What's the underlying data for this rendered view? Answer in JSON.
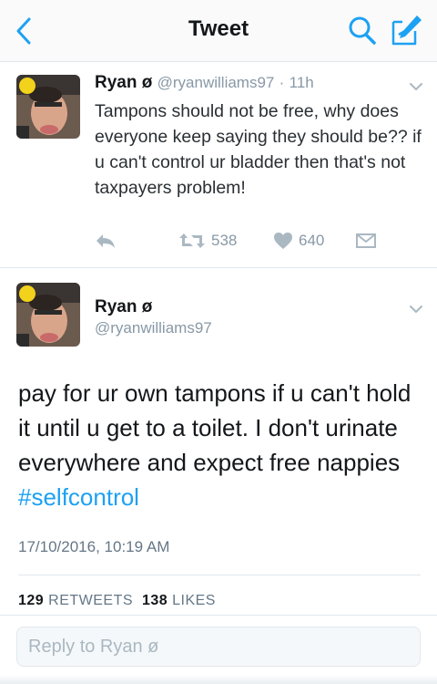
{
  "header": {
    "title": "Tweet",
    "back_icon": "chevron-left-icon",
    "search_icon": "search-icon",
    "compose_icon": "compose-icon"
  },
  "tweet1": {
    "name": "Ryan ø",
    "handle": "@ryanwilliams97",
    "separator": "·",
    "time": "11h",
    "text": "Tampons should not be free, why does everyone keep saying they should be?? if u can't control ur bladder then that's not taxpayers problem!",
    "retweet_count": "538",
    "like_count": "640"
  },
  "tweet2": {
    "name": "Ryan ø",
    "handle": "@ryanwilliams97",
    "text": "pay for ur own tampons if u can't hold it until u get to a toilet. I don't urinate everywhere and expect free nappies",
    "hashtag": "#selfcontrol",
    "date": "17/10/2016, 10:19 AM",
    "retweets_value": "129",
    "retweets_label": "RETWEETS",
    "likes_value": "138",
    "likes_label": "LIKES"
  },
  "reply": {
    "placeholder": "Reply to Ryan ø"
  },
  "colors": {
    "accent": "#1da1f2",
    "icon_gray": "#aab8c2",
    "text_secondary": "#8899a6"
  }
}
